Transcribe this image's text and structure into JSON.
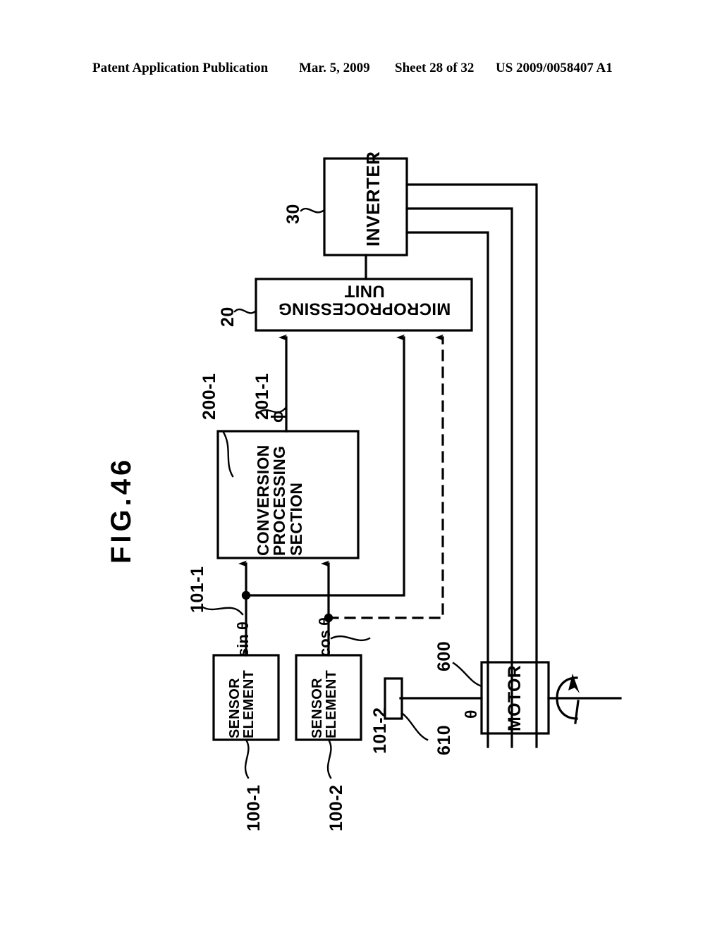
{
  "header": {
    "left": "Patent Application Publication",
    "date": "Mar. 5, 2009",
    "sheet": "Sheet 28 of 32",
    "publication_number": "US 2009/0058407 A1"
  },
  "figure": {
    "title": "FIG.46",
    "blocks": [
      {
        "id": "inverter",
        "label": "INVERTER",
        "ref": "30"
      },
      {
        "id": "mpu",
        "label_line1": "MICROPROCESSING",
        "label_line2": "UNIT",
        "ref": "20"
      },
      {
        "id": "conversion",
        "label_line1": "CONVERSION",
        "label_line2": "PROCESSING",
        "label_line3": "SECTION",
        "ref": "200-1"
      },
      {
        "id": "sensor1",
        "label_line1": "SENSOR",
        "label_line2": "ELEMENT",
        "ref": "100-1"
      },
      {
        "id": "sensor2",
        "label_line1": "SENSOR",
        "label_line2": "ELEMENT",
        "ref": "100-2"
      },
      {
        "id": "motor",
        "label": "MOTOR",
        "ref": "600"
      },
      {
        "id": "magnet",
        "label": "",
        "ref": "610"
      }
    ],
    "reference_numerals": {
      "inverter": "30",
      "microprocessing_unit": "20",
      "conversion_processing_section": "200-1",
      "conversion_output_line": "201-1",
      "sin_signal_line": "101-1",
      "cos_signal_line": "101-2",
      "sensor_element_1": "100-1",
      "sensor_element_2": "100-2",
      "motor": "600",
      "rotor_magnet": "610"
    },
    "signal_labels": {
      "phi": "ϕ",
      "sin_theta": "sin θ",
      "cos_theta": "cos θ",
      "theta": "θ"
    },
    "colors": {
      "ink": "#000000",
      "paper": "#ffffff"
    }
  }
}
